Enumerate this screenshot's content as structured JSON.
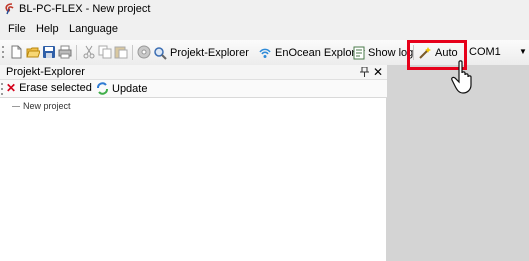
{
  "window": {
    "title": "BL-PC-FLEX - New project"
  },
  "menu": {
    "file": "File",
    "help": "Help",
    "language": "Language"
  },
  "toolbar": {
    "projekt_explorer": "Projekt-Explorer",
    "enocean_explorer": "EnOcean Explorer",
    "show_log": "Show log",
    "auto": "Auto",
    "port": "COM1"
  },
  "panel": {
    "title": "Projekt-Explorer",
    "erase_selected": "Erase selected",
    "update": "Update",
    "tree": [
      {
        "label": "New project"
      }
    ]
  },
  "colors": {
    "highlight": "#e6001a",
    "workspace": "#d4d4d4",
    "chrome": "#f0f0f0"
  }
}
